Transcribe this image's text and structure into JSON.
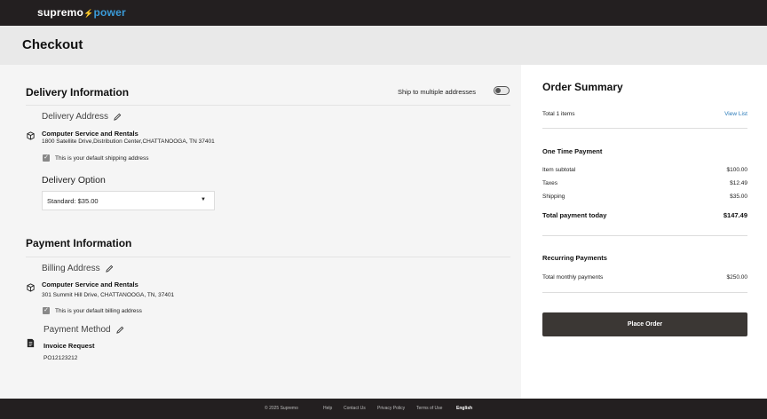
{
  "header": {
    "logo_main": "supremo",
    "logo_accent": "power"
  },
  "page": {
    "title": "Checkout"
  },
  "delivery": {
    "title": "Delivery Information",
    "multi_toggle_label": "Ship to multiple addresses",
    "address_title": "Delivery Address",
    "address_name": "Computer Service and Rentals",
    "address_line": "1800 Satellite Drive,Distribution Center,CHATTANOOGA, TN 37401",
    "default_label": "This is your default shipping address",
    "option_title": "Delivery Option",
    "option_selected": "Standard: $35.00"
  },
  "payment": {
    "title": "Payment Information",
    "billing_title": "Billing Address",
    "billing_name": "Computer Service and Rentals",
    "billing_line": "301 Summit Hill Drive, CHATTANOOGA, TN, 37401",
    "default_label": "This is your default billing address",
    "method_title": "Payment Method",
    "method_name": "Invoice Request",
    "method_ref": "PO12123212"
  },
  "summary": {
    "title": "Order Summary",
    "total_items": "Total 1 items",
    "view_list": "View List",
    "one_time_title": "One Time Payment",
    "subtotal_label": "Item subtotal",
    "subtotal_value": "$100.00",
    "taxes_label": "Taxes",
    "taxes_value": "$12.49",
    "shipping_label": "Shipping",
    "shipping_value": "$35.00",
    "total_label": "Total payment today",
    "total_value": "$147.49",
    "recurring_title": "Recurring Payments",
    "monthly_label": "Total monthly payments",
    "monthly_value": "$250.00",
    "place_order": "Place Order"
  },
  "footer": {
    "copyright": "© 2025 Supremo",
    "help": "Help",
    "contact": "Contact Us",
    "privacy": "Privacy Policy",
    "terms": "Terms of Use",
    "language": "English"
  },
  "colors": {
    "header_bg": "#231f20",
    "accent": "#3a9bd9",
    "link": "#2b7bb9",
    "button_bg": "#3b3734"
  }
}
